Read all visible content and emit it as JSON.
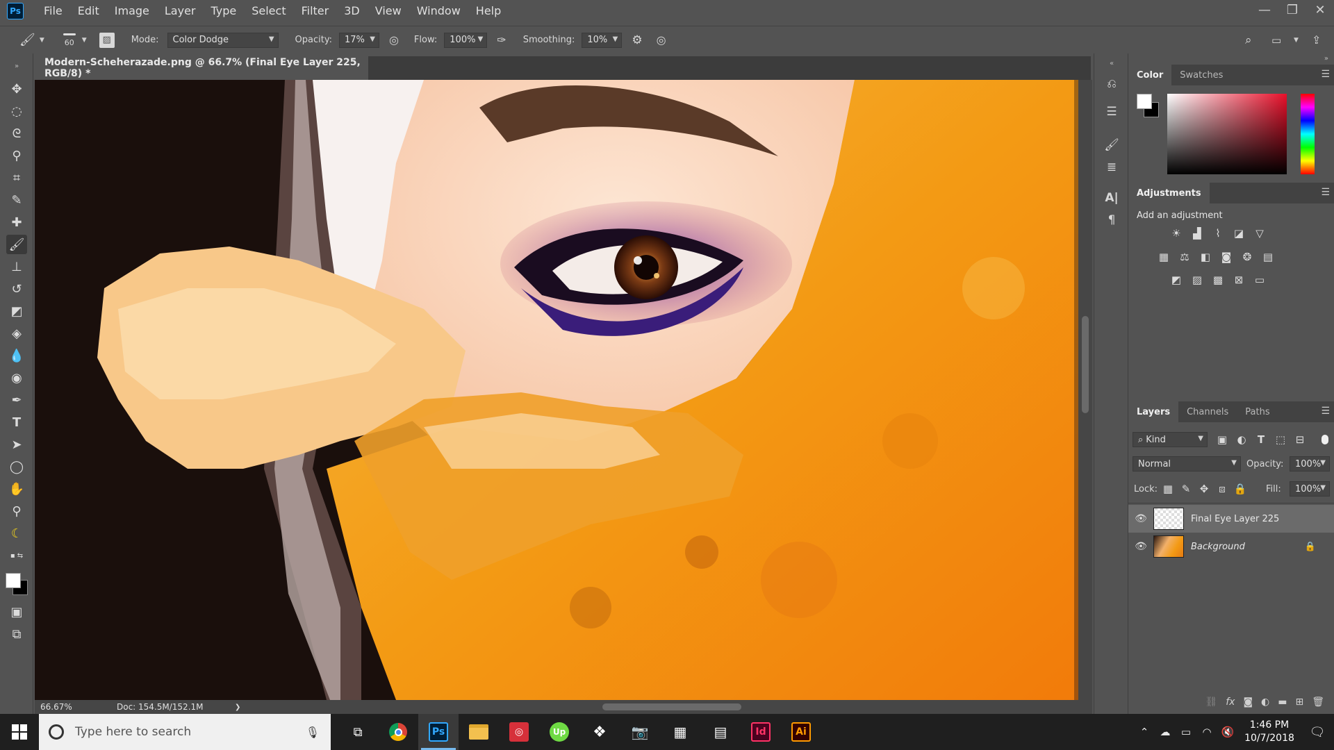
{
  "app": {
    "logo": "Ps"
  },
  "menu": [
    "File",
    "Edit",
    "Image",
    "Layer",
    "Type",
    "Select",
    "Filter",
    "3D",
    "View",
    "Window",
    "Help"
  ],
  "window_controls": {
    "minimize": "—",
    "restore": "❐",
    "close": "✕"
  },
  "options": {
    "brush_size": "60",
    "mode_label": "Mode:",
    "mode_value": "Color Dodge",
    "opacity_label": "Opacity:",
    "opacity_value": "17%",
    "flow_label": "Flow:",
    "flow_value": "100%",
    "smoothing_label": "Smoothing:",
    "smoothing_value": "10%"
  },
  "document": {
    "tab_title": "Modern-Scheherazade.png @ 66.7% (Final Eye Layer 225, RGB/8) *"
  },
  "status": {
    "zoom": "66.67%",
    "doc_info": "Doc: 154.5M/152.1M",
    "arrow": "❯"
  },
  "panels": {
    "color_tabs": [
      "Color",
      "Swatches"
    ],
    "adjustments_title": "Adjustments",
    "adjustments_subtitle": "Add an adjustment",
    "layers_tabs": [
      "Layers",
      "Channels",
      "Paths"
    ],
    "filter_kind": "Kind",
    "blend_mode": "Normal",
    "opacity_label": "Opacity:",
    "opacity_value": "100%",
    "lock_label": "Lock:",
    "fill_label": "Fill:",
    "fill_value": "100%",
    "layers": [
      {
        "name": "Final Eye Layer 225",
        "selected": true
      },
      {
        "name": "Background",
        "selected": false,
        "locked": true
      }
    ]
  },
  "taskbar": {
    "search_placeholder": "Type here to search",
    "apps": [
      {
        "name": "chrome",
        "label": ""
      },
      {
        "name": "photoshop",
        "label": "Ps"
      },
      {
        "name": "file-explorer",
        "label": ""
      },
      {
        "name": "instagram",
        "label": ""
      },
      {
        "name": "upwork",
        "label": "Up"
      },
      {
        "name": "dropbox",
        "label": ""
      },
      {
        "name": "camera",
        "label": ""
      },
      {
        "name": "calendar",
        "label": ""
      },
      {
        "name": "calculator",
        "label": ""
      },
      {
        "name": "indesign",
        "label": "Id"
      },
      {
        "name": "illustrator",
        "label": "Ai"
      }
    ],
    "time": "1:46 PM",
    "date": "10/7/2018"
  },
  "colors": {
    "ui_bg": "#535353",
    "ps_blue": "#31a8ff",
    "accent_orange": "#f4a21a"
  }
}
